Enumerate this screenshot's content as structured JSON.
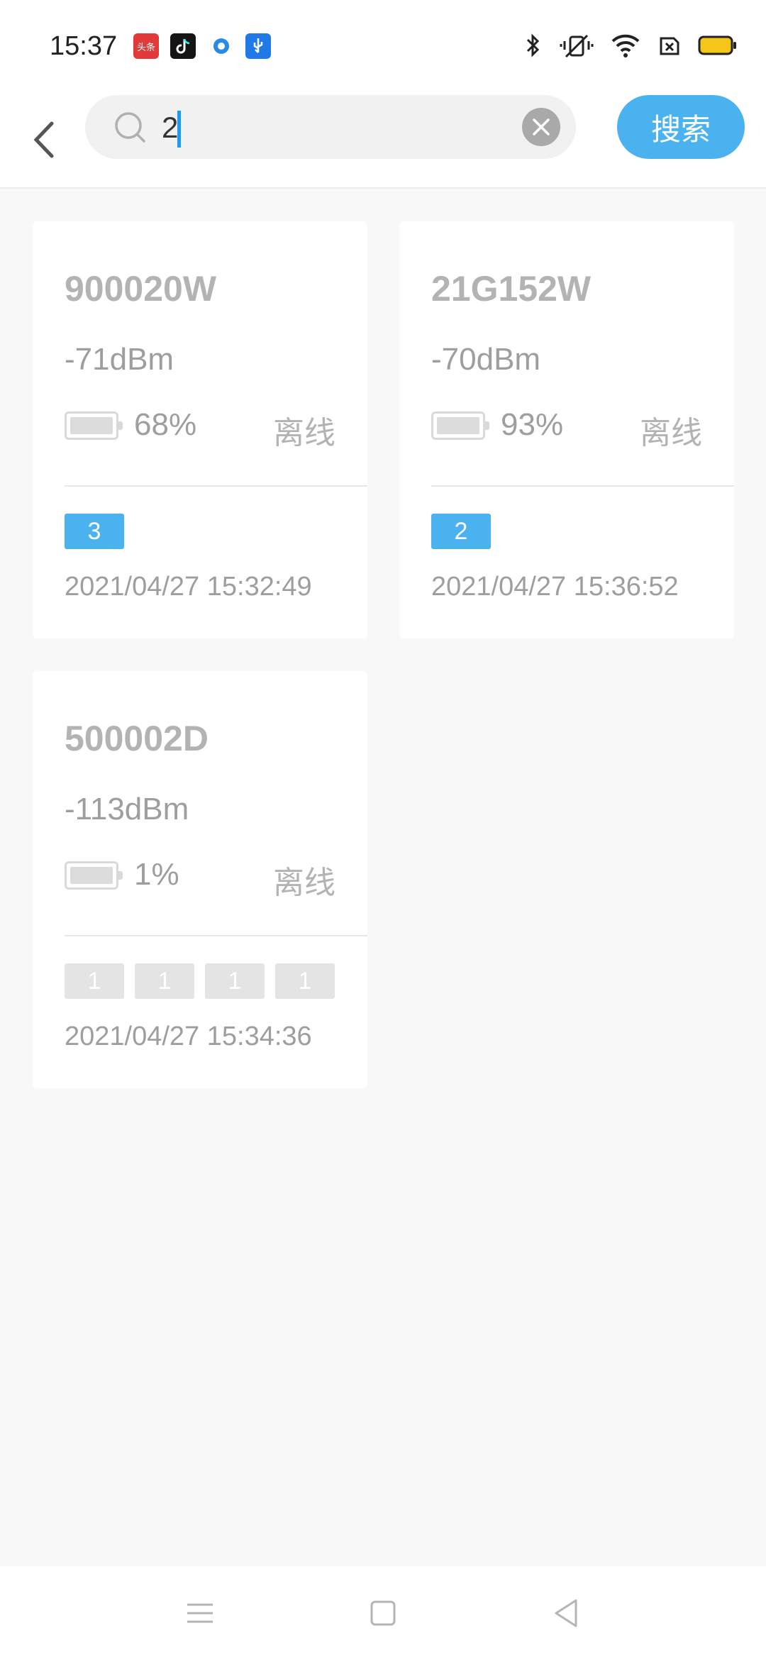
{
  "status_bar": {
    "time": "15:37",
    "app_icons": [
      "toutiao-icon",
      "tiktok-icon",
      "circle-app-icon",
      "usb-icon"
    ],
    "system_icons": [
      "bluetooth-icon",
      "vibrate-mute-icon",
      "wifi-icon",
      "sim-card-icon",
      "battery-icon"
    ]
  },
  "header": {
    "search": {
      "value": "2"
    },
    "search_button_label": "搜索"
  },
  "devices": [
    {
      "name": "900020W",
      "signal": "-71dBm",
      "battery_level": 0.68,
      "battery_text": "68%",
      "status": "离线",
      "tags": [
        {
          "label": "3",
          "color": "blue"
        }
      ],
      "time": "2021/04/27 15:32:49"
    },
    {
      "name": "21G152W",
      "signal": "-70dBm",
      "battery_level": 0.93,
      "battery_text": "93%",
      "status": "离线",
      "tags": [
        {
          "label": "2",
          "color": "blue"
        }
      ],
      "time": "2021/04/27 15:36:52"
    },
    {
      "name": "500002D",
      "signal": "-113dBm",
      "battery_level": 0.01,
      "battery_text": "1%",
      "status": "离线",
      "tags": [
        {
          "label": "1",
          "color": "gray"
        },
        {
          "label": "1",
          "color": "gray"
        },
        {
          "label": "1",
          "color": "gray"
        },
        {
          "label": "1",
          "color": "gray"
        }
      ],
      "time": "2021/04/27 15:34:36"
    }
  ],
  "colors": {
    "accent": "#4bb2f0",
    "tag_gray": "#e4e4e4",
    "text_gray": "#9e9e9e"
  }
}
